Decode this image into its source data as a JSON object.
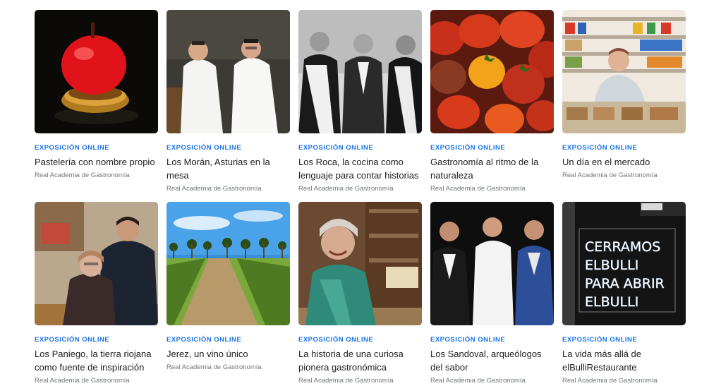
{
  "cards": [
    {
      "kicker": "EXPOSICIÓN ONLINE",
      "title": "Pastelería con nombre propio",
      "source": "Real Academia de Gastronomía",
      "image": "red glazed apple dessert on pastry base"
    },
    {
      "kicker": "EXPOSICIÓN ONLINE",
      "title": "Los Morán, Asturias en la mesa",
      "source": "Real Academia de Gastronomía",
      "image": "two chefs in white jackets"
    },
    {
      "kicker": "EXPOSICIÓN ONLINE",
      "title": "Los Roca, la cocina como lenguaje para contar historias",
      "source": "Real Academia de Gastronomía",
      "image": "three brothers black and white photo"
    },
    {
      "kicker": "EXPOSICIÓN ONLINE",
      "title": "Gastronomía al ritmo de la naturaleza",
      "source": "Real Academia de Gastronomía",
      "image": "heirloom tomatoes"
    },
    {
      "kicker": "EXPOSICIÓN ONLINE",
      "title": "Un día en el mercado",
      "source": "Real Academia de Gastronomía",
      "image": "woman at market stall"
    },
    {
      "kicker": "EXPOSICIÓN ONLINE",
      "title": "Los Paniego, la tierra riojana como fuente de inspiración",
      "source": "Real Academia de Gastronomía",
      "image": "mother and son embracing"
    },
    {
      "kicker": "EXPOSICIÓN ONLINE",
      "title": "Jerez, un vino único",
      "source": "Real Academia de Gastronomía",
      "image": "vineyard with palm trees"
    },
    {
      "kicker": "EXPOSICIÓN ONLINE",
      "title": "La historia de una curiosa pionera gastronómica",
      "source": "Real Academia de Gastronomía",
      "image": "smiling elderly woman in green"
    },
    {
      "kicker": "EXPOSICIÓN ONLINE",
      "title": "Los Sandoval, arqueólogos del sabor",
      "source": "Real Academia de Gastronomía",
      "image": "three men in suits and chef jacket"
    },
    {
      "kicker": "EXPOSICIÓN ONLINE",
      "title": "La vida más allá de elBulliRestaurante",
      "source": "Real Academia de Gastronomía",
      "image": "neon sign",
      "sign_lines": [
        "CERRAMOS",
        "ELBULLI",
        "PARA ABRIR",
        "ELBULLI"
      ]
    }
  ]
}
